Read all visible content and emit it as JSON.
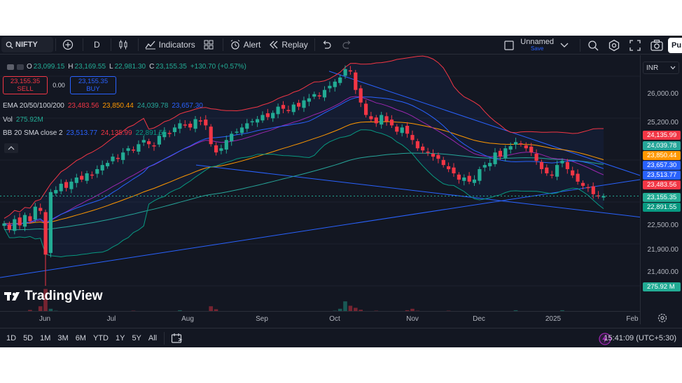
{
  "toolbar": {
    "symbol": "NIFTY",
    "interval": "D",
    "indicators_label": "Indicators",
    "alert_label": "Alert",
    "replay_label": "Replay",
    "layout_name": "Unnamed",
    "layout_status": "Save",
    "publish_label": "Pu"
  },
  "legend": {
    "open_key": "O",
    "open": "23,099.15",
    "high_key": "H",
    "high": "23,169.55",
    "low_key": "L",
    "low": "22,981.30",
    "close_key": "C",
    "close": "23,155.35",
    "change": "+130.70 (+0.57%)",
    "sell_price": "23,155.35",
    "sell_label": "SELL",
    "spread": "0.00",
    "buy_price": "23,155.35",
    "buy_label": "BUY",
    "ema_label": "EMA 20/50/100/200",
    "ema20": "23,483.56",
    "ema50": "23,850.44",
    "ema100": "24,039.78",
    "ema200": "23,657.30",
    "vol_label": "Vol",
    "vol": "275.92M",
    "bb_label": "BB 20 SMA close 2",
    "bb_basis": "23,513.77",
    "bb_upper": "24,135.99",
    "bb_lower": "22,891.55"
  },
  "colors": {
    "up": "#22ab94",
    "down": "#f23645",
    "ema20": "#f23645",
    "ema50": "#ff9800",
    "ema100": "#26a69a",
    "ema200": "#2962ff",
    "bb_basis": "#2962ff",
    "bb_upper": "#f23645",
    "bb_lower": "#089981"
  },
  "price_scale": {
    "currency": "INR",
    "ticks": [
      "26,000.00",
      "25,200.00",
      "22,500.00",
      "21,900.00",
      "21,400.00"
    ],
    "labels": [
      {
        "text": "24,135.99",
        "color": "#f23645"
      },
      {
        "text": "24,039.78",
        "color": "#26a69a"
      },
      {
        "text": "23,850.44",
        "color": "#ff9800"
      },
      {
        "text": "23,657.30",
        "color": "#2962ff"
      },
      {
        "text": "23,513.77",
        "color": "#2962ff"
      },
      {
        "text": "23,483.56",
        "color": "#f23645"
      },
      {
        "text": "23,155.35",
        "color": "#22ab94"
      },
      {
        "text": "22,891.55",
        "color": "#089981"
      },
      {
        "text": "275.92 M",
        "color": "#22ab94"
      }
    ]
  },
  "time_axis": [
    "Jun",
    "Jul",
    "Aug",
    "Sep",
    "Oct",
    "Nov",
    "Dec",
    "2025",
    "Feb"
  ],
  "watermark": "TradingView",
  "ranges": [
    "1D",
    "5D",
    "1M",
    "3M",
    "6M",
    "YTD",
    "1Y",
    "5Y",
    "All"
  ],
  "clock": "15:41:09 (UTC+5:30)",
  "chart_data": {
    "type": "candlestick",
    "ylim": [
      21000,
      26400
    ],
    "close_series": [
      22500,
      22350,
      22600,
      22450,
      22700,
      22550,
      22900,
      22800,
      21750,
      23250,
      23300,
      23450,
      23350,
      23500,
      23600,
      23550,
      23700,
      23650,
      23800,
      23900,
      23950,
      24100,
      24050,
      24200,
      24300,
      24250,
      24400,
      24500,
      24400,
      24350,
      24600,
      24700,
      24650,
      24800,
      24900,
      24850,
      24800,
      25000,
      24950,
      24850,
      24400,
      24200,
      24300,
      24500,
      24650,
      24700,
      24800,
      24900,
      24950,
      25000,
      25100,
      25050,
      25150,
      25300,
      25250,
      25200,
      25350,
      25300,
      25450,
      25500,
      25600,
      25550,
      25700,
      25800,
      25900,
      26000,
      26200,
      26150,
      25700,
      25400,
      25100,
      25000,
      24900,
      25100,
      24950,
      24850,
      24700,
      24800,
      24650,
      24500,
      24300,
      24250,
      24200,
      24100,
      24050,
      23900,
      23800,
      23700,
      23550,
      23600,
      23500,
      23550,
      23800,
      23900,
      23950,
      24200,
      24100,
      24300,
      24350,
      24450,
      24400,
      24300,
      24200,
      24000,
      23800,
      23700,
      23650,
      23900,
      24000,
      23800,
      23650,
      23500,
      23400,
      23350,
      23200,
      23150,
      23155
    ],
    "volume_series": [
      60,
      55,
      70,
      58,
      62,
      75,
      68,
      90,
      160,
      80,
      72,
      66,
      60,
      70,
      62,
      58,
      66,
      60,
      55,
      62,
      70,
      58,
      64,
      60,
      66,
      72,
      60,
      58,
      64,
      70,
      62,
      58,
      60,
      66,
      74,
      62,
      58,
      60,
      66,
      62,
      90,
      78,
      70,
      62,
      60,
      58,
      64,
      66,
      60,
      62,
      58,
      64,
      70,
      62,
      60,
      58,
      64,
      66,
      62,
      60,
      58,
      64,
      70,
      66,
      72,
      80,
      110,
      92,
      84,
      76,
      70,
      66,
      72,
      68,
      64,
      70,
      66,
      62,
      74,
      80,
      72,
      66,
      70,
      62,
      58,
      66,
      72,
      64,
      60,
      66,
      70,
      62,
      68,
      64,
      60,
      66,
      70,
      62,
      66,
      74,
      70,
      62,
      58,
      66,
      64,
      60,
      66,
      70,
      74,
      62,
      66,
      60,
      58,
      62,
      66,
      60,
      62
    ]
  }
}
